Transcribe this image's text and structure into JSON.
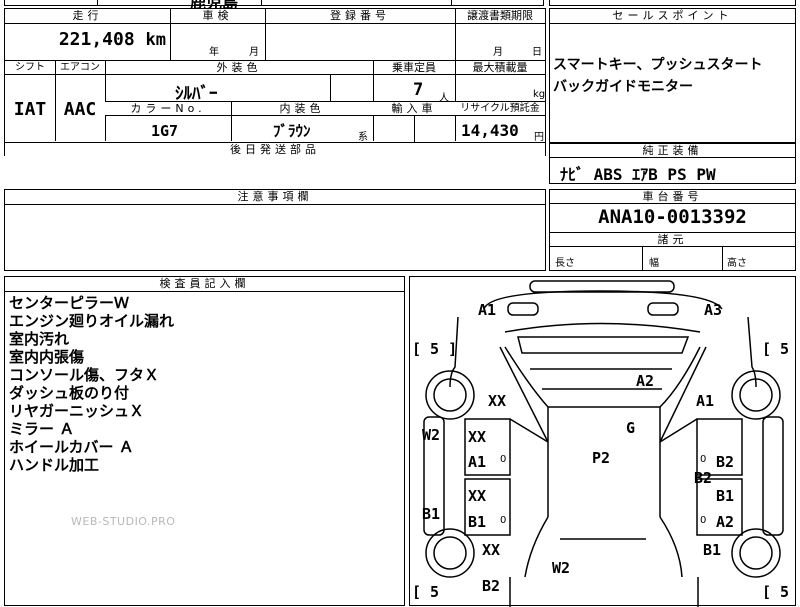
{
  "top_fragment": "鹿児島",
  "mileage": {
    "header": "走行",
    "value": "221,408",
    "unit": "km"
  },
  "inspection": {
    "header": "車検",
    "year": "年",
    "month": "月"
  },
  "registration": {
    "header": "登録番号"
  },
  "transfer": {
    "header": "譲渡書類期限",
    "month": "月",
    "day": "日"
  },
  "sales_points": {
    "header": "セールスポイント",
    "lines": [
      "スマートキー、プッシュスタート",
      "バックガイドモニター"
    ]
  },
  "shift": {
    "header": "シフト",
    "value": "IAT"
  },
  "aircon": {
    "header": "エアコン",
    "value": "AAC"
  },
  "exterior_color": {
    "header": "外装色",
    "value": "ｼﾙﾊﾞｰ"
  },
  "capacity": {
    "header": "乗車定員",
    "value": "7",
    "unit": "人"
  },
  "max_load": {
    "header": "最大積載量",
    "unit": "kg"
  },
  "color_no": {
    "header": "カラーNo.",
    "value": "1G7"
  },
  "interior_color": {
    "header": "内装色",
    "value": "ﾌﾞﾗｳﾝ",
    "suffix": "系"
  },
  "import_car": {
    "header": "輸入車"
  },
  "recycle": {
    "header": "リサイクル預託金",
    "value": "14,430",
    "unit": "円"
  },
  "later_parts": {
    "header": "後日発送部品"
  },
  "genuine_equipment": {
    "header": "純正装備",
    "value": "ﾅﾋﾞ ABS ｴｱB PS PW"
  },
  "caution": {
    "header": "注意事項欄"
  },
  "chassis": {
    "header": "車台番号",
    "value": "ANA10-0013392"
  },
  "specs": {
    "header": "諸元",
    "length": "長さ",
    "width": "幅",
    "height": "高さ"
  },
  "inspector": {
    "header": "検査員記入欄",
    "notes": [
      "センターピラーＷ",
      "エンジン廻りオイル漏れ",
      "室内汚れ",
      "室内内張傷",
      "コンソール傷、フタＸ",
      "ダッシュ板のり付",
      "リヤガーニッシュＸ",
      "ミラー Ａ",
      "ホイールカバー Ａ",
      "ハンドル加工"
    ]
  },
  "watermark": "WEB-STUDIO.PRO",
  "diagram": {
    "brackets": [
      "[ 5 ]",
      "[ 5",
      "[ 5",
      "[ 5"
    ],
    "marks": [
      "A1",
      "A3",
      "A2",
      "XX",
      "A1",
      "G",
      "W2",
      "XX",
      "A1",
      "P2",
      "B2",
      "B2",
      "XX",
      "B1",
      "B1",
      "B1",
      "A2",
      "XX",
      "B1",
      "W2",
      "B2"
    ],
    "zeros": [
      "0",
      "0",
      "0",
      "0"
    ]
  }
}
